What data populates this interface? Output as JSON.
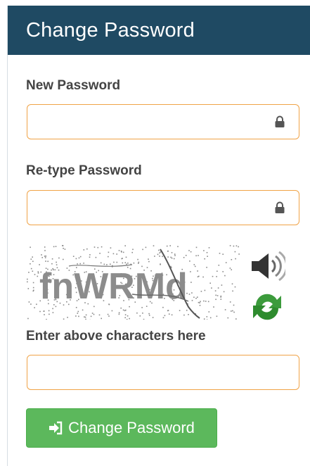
{
  "panel": {
    "title": "Change Password"
  },
  "form": {
    "new_password": {
      "label": "New Password",
      "value": "",
      "icon": "lock-icon"
    },
    "retype_password": {
      "label": "Re-type Password",
      "value": "",
      "icon": "lock-icon"
    },
    "captcha": {
      "text": "fnWRMd",
      "audio_icon": "speaker-icon",
      "refresh_icon": "refresh-icon",
      "input_label": "Enter above characters here",
      "input_value": ""
    },
    "submit": {
      "label": "Change Password",
      "icon": "sign-in-icon"
    }
  },
  "colors": {
    "header_bg": "#1f4a63",
    "field_border": "#f0a347",
    "button_bg": "#5cb85c"
  }
}
